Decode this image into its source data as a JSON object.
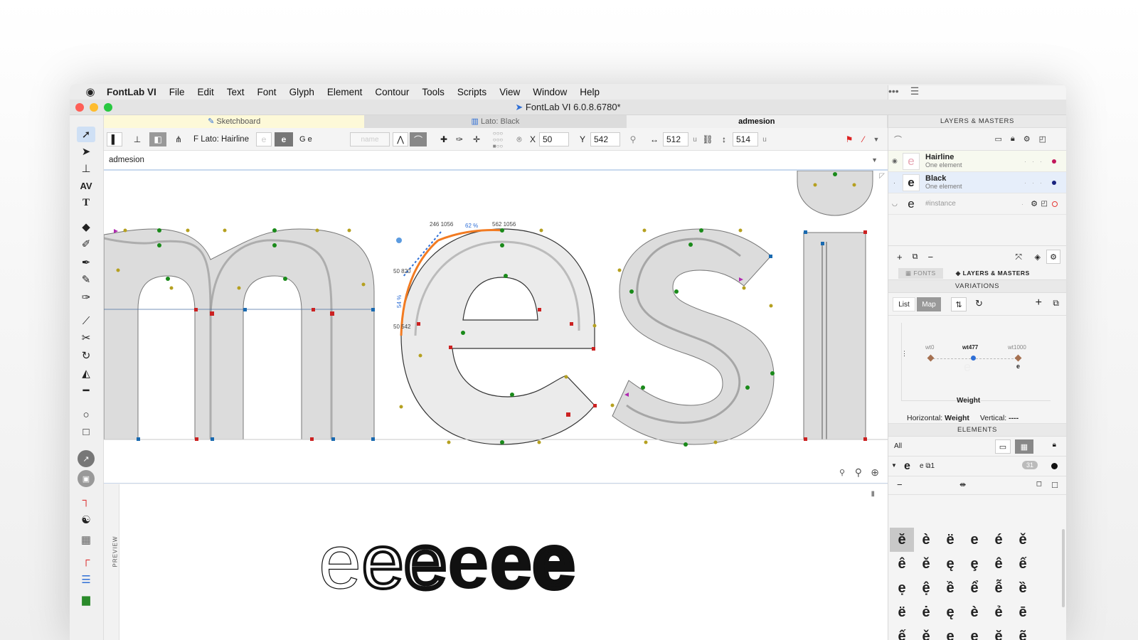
{
  "menubar": {
    "app": "FontLab VI",
    "items": [
      "File",
      "Edit",
      "Text",
      "Font",
      "Glyph",
      "Element",
      "Contour",
      "Tools",
      "Scripts",
      "View",
      "Window",
      "Help"
    ]
  },
  "window": {
    "title": "FontLab VI 6.0.8.6780*"
  },
  "tabs": [
    {
      "label": "Sketchboard"
    },
    {
      "label": "Lato: Black"
    },
    {
      "label": "admesion"
    }
  ],
  "toolbar": {
    "font_label": "F Lato: Hairline",
    "glyph_e": "e",
    "glyph_ge": "G e",
    "name_placeholder": "name",
    "x_label": "X",
    "x_value": "50",
    "y_label": "Y",
    "y_value": "542",
    "width_value": "512",
    "height_value": "514",
    "unit": "u"
  },
  "text_field": {
    "value": "admesion"
  },
  "canvas": {
    "labels": [
      "246 1056",
      "62 %",
      "562 1056",
      "50 820",
      "54 %",
      "50 542"
    ]
  },
  "preview": {
    "label": "PREVIEW",
    "text": "eeeeee"
  },
  "panel": {
    "layers_header": "LAYERS & MASTERS",
    "layers": [
      {
        "name": "Hairline",
        "sub": "One element",
        "glyph": "e",
        "color": "#c2185b"
      },
      {
        "name": "Black",
        "sub": "One element",
        "glyph": "e",
        "color": "#1a237e"
      },
      {
        "name": "#instance",
        "sub": "",
        "glyph": "e",
        "color": "#e53935"
      }
    ],
    "tab_fonts": "FONTS",
    "tab_layers": "LAYERS & MASTERS",
    "variations_header": "VARIATIONS",
    "var_list": "List",
    "var_map": "Map",
    "axis_points": [
      "wt0",
      "wt477",
      "wt1000"
    ],
    "axis_name": "Weight",
    "horizontal_label": "Horizontal:",
    "horizontal_value": "Weight",
    "vertical_label": "Vertical:",
    "vertical_value": "----",
    "elements_header": "ELEMENTS",
    "elements_filter": "All",
    "element_name": "e",
    "element_ref": "e ⧉1",
    "element_count": "31",
    "glyphs": [
      [
        "ĕ",
        "è",
        "ë",
        "e",
        "é",
        "ě"
      ],
      [
        "ê",
        "ě",
        "ę",
        "ȩ",
        "ê",
        "ế"
      ],
      [
        "ẹ",
        "ệ",
        "ề",
        "ể",
        "ễ",
        "ȅ"
      ],
      [
        "ë",
        "ė",
        "ę",
        "è",
        "ẻ",
        "ē"
      ],
      [
        "ế",
        "ě",
        "ę",
        "ẹ",
        "ḝ",
        "ẽ"
      ]
    ]
  }
}
